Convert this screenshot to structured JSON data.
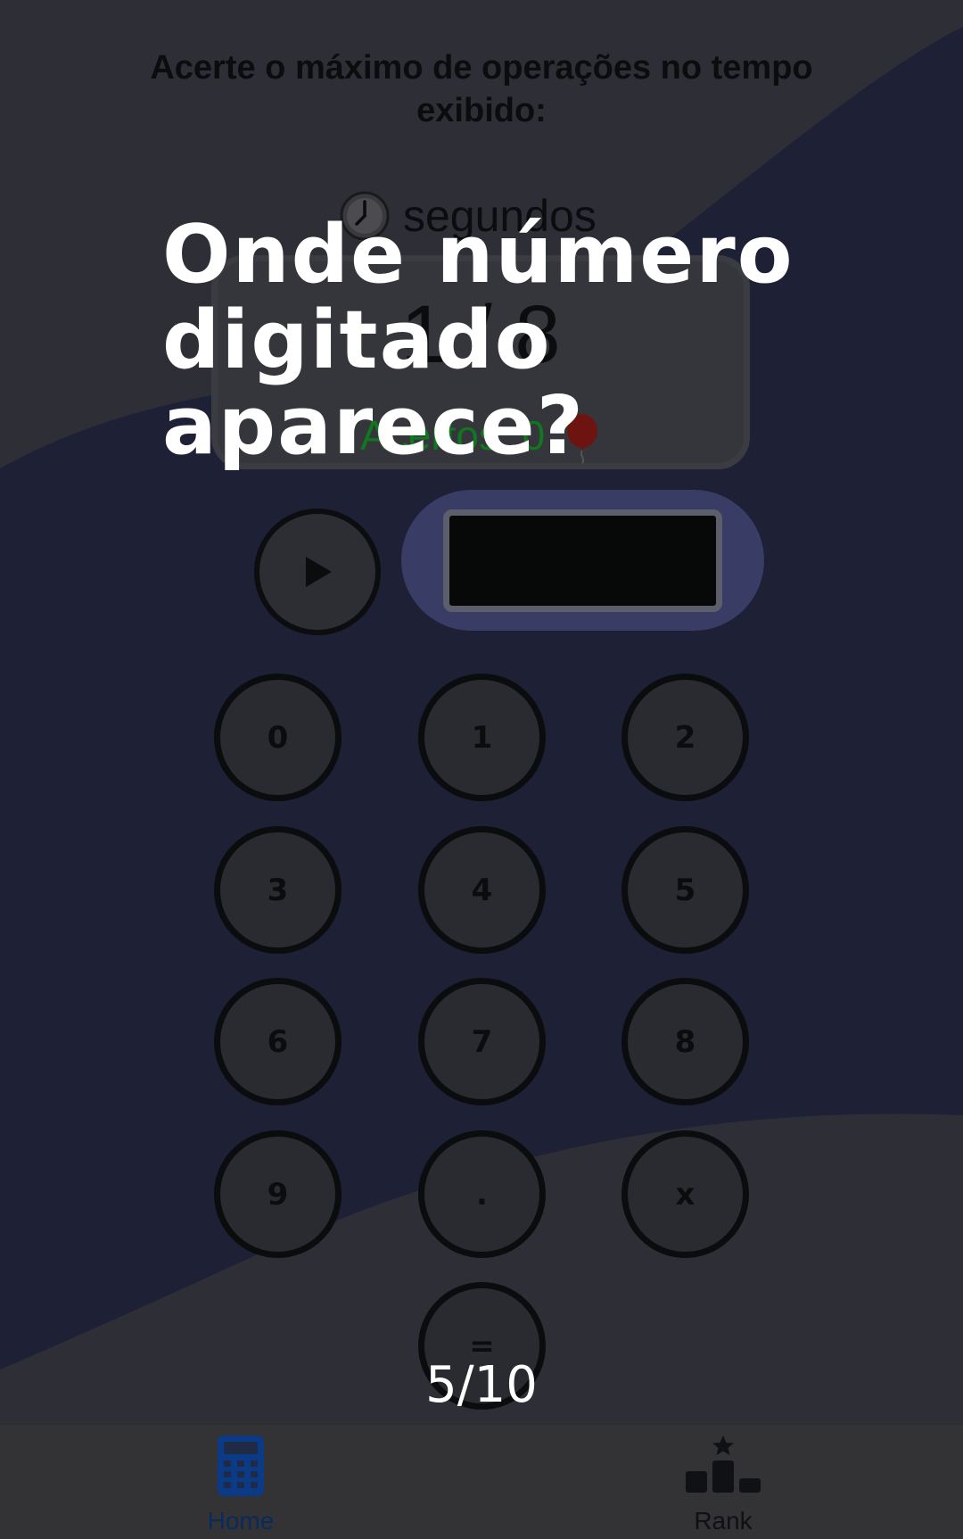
{
  "game": {
    "instructions": "Acerte o máximo de operações no tempo exibido:",
    "timer_label": "segundos",
    "progress": "1 / 8",
    "hits_label": "Acertos: 0"
  },
  "icons": {
    "clock": "clock-icon",
    "balloon": "balloon-icon",
    "play": "play-icon",
    "home": "calculator-icon",
    "rank": "podium-star-icon"
  },
  "keypad": {
    "keys": [
      "0",
      "1",
      "2",
      "3",
      "4",
      "5",
      "6",
      "7",
      "8",
      "9",
      ".",
      "x",
      "="
    ]
  },
  "overlay": {
    "title": "Onde número digitado aparece?",
    "counter": "5/10"
  },
  "nav": {
    "home_label": "Home",
    "rank_label": "Rank"
  },
  "colors": {
    "background": "#2e2f36",
    "wave": "#1e2035",
    "accent_blue": "#0b3a86",
    "hits_green": "#10771f"
  }
}
